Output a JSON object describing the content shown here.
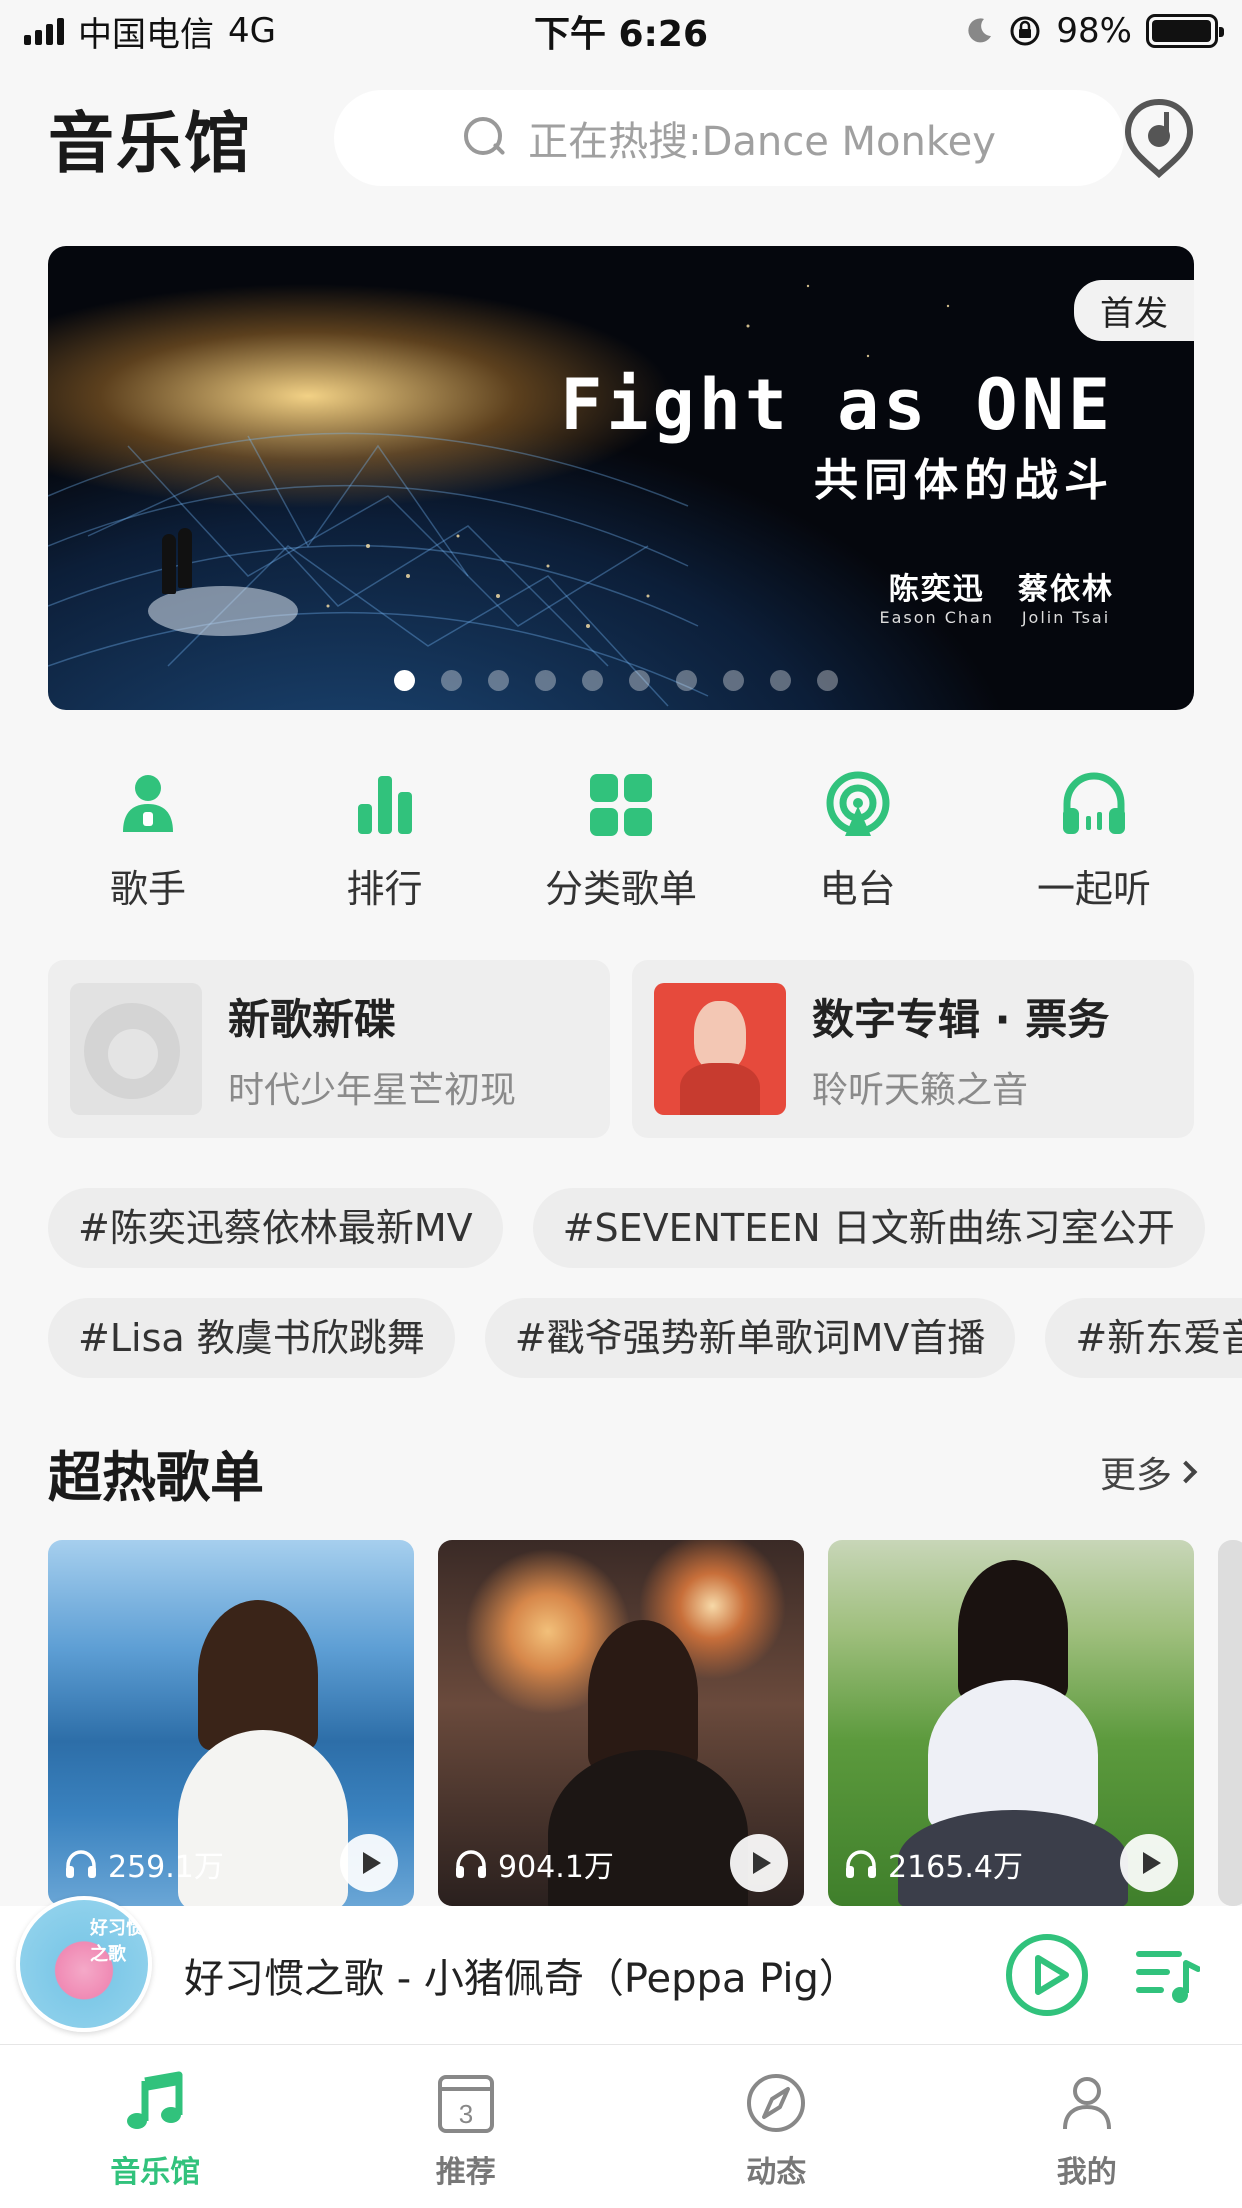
{
  "status_bar": {
    "carrier": "中国电信",
    "network": "4G",
    "time": "下午 6:26",
    "battery": "98%",
    "battery_level": 0.98
  },
  "header": {
    "title": "音乐馆",
    "search_placeholder": "正在热搜:Dance Monkey",
    "recognize_icon": "music-recognition-icon"
  },
  "banner": {
    "badge": "首发",
    "title": "Fight as ONE",
    "subtitle": "共同体的战斗",
    "artists": [
      {
        "name": "陈奕迅",
        "en": "Eason Chan"
      },
      {
        "name": "蔡依林",
        "en": "Jolin Tsai"
      }
    ],
    "slide_count": 10,
    "active_slide": 1
  },
  "quick_nav": [
    {
      "label": "歌手",
      "icon": "singer-icon"
    },
    {
      "label": "排行",
      "icon": "chart-icon"
    },
    {
      "label": "分类歌单",
      "icon": "category-icon"
    },
    {
      "label": "电台",
      "icon": "radio-icon"
    },
    {
      "label": "一起听",
      "icon": "listen-together-icon"
    }
  ],
  "features": [
    {
      "title": "新歌新碟",
      "subtitle": "时代少年星芒初现"
    },
    {
      "title": "数字专辑 · 票务",
      "subtitle": "聆听天籁之音"
    }
  ],
  "tags_row1": [
    "#陈奕迅蔡依林最新MV",
    "#SEVENTEEN 日文新曲练习室公开"
  ],
  "tags_row2": [
    "#Lisa 教虞书欣跳舞",
    "#戳爷强势新单歌词MV首播",
    "#新东爱音"
  ],
  "section": {
    "title": "超热歌单",
    "more": "更多"
  },
  "playlists": [
    {
      "plays": "259.1万"
    },
    {
      "plays": "904.1万"
    },
    {
      "plays": "2165.4万"
    }
  ],
  "mini_player": {
    "cover_text": "好习惯之歌",
    "title": "好习惯之歌 - 小猪佩奇（Peppa Pig）"
  },
  "tabs": [
    {
      "label": "音乐馆",
      "icon": "music-note-icon",
      "active": true
    },
    {
      "label": "推荐",
      "icon": "calendar-icon",
      "badge": "3"
    },
    {
      "label": "动态",
      "icon": "compass-icon"
    },
    {
      "label": "我的",
      "icon": "profile-icon"
    }
  ],
  "colors": {
    "accent": "#31c27c",
    "background": "#f7f7f7"
  }
}
